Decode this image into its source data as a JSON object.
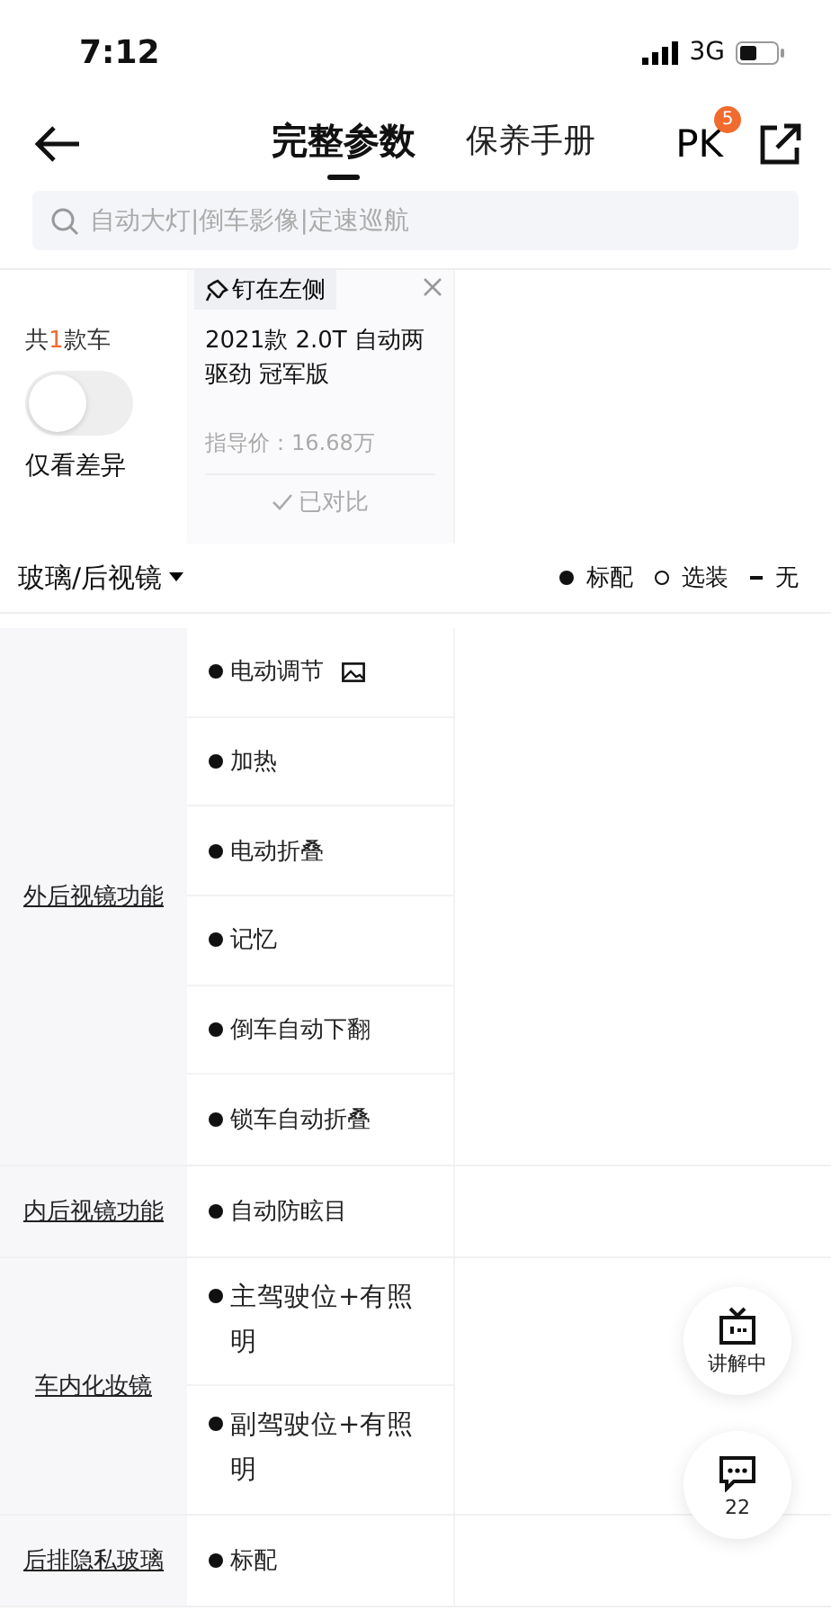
{
  "status_bar": {
    "time": "7:12",
    "network": "3G"
  },
  "nav": {
    "tabs": [
      {
        "label": "完整参数",
        "selected": true
      },
      {
        "label": "保养手册",
        "selected": false
      }
    ],
    "pk": {
      "label": "PK",
      "badge": "5"
    }
  },
  "search": {
    "placeholder": "自动大灯|倒车影像|定速巡航"
  },
  "header": {
    "count": {
      "before": "共",
      "number": "1",
      "after": "款车"
    },
    "diff_toggle": {
      "label": "仅看差异",
      "on": false
    },
    "car": {
      "pin": "钉在左侧",
      "name": "2021款 2.0T 自动两驱劲 冠军版",
      "price": "指导价：16.68万",
      "compared": "已对比"
    }
  },
  "section": {
    "title": "玻璃/后视镜",
    "legend": [
      {
        "kind": "standard",
        "label": "标配"
      },
      {
        "kind": "optional",
        "label": "选装"
      },
      {
        "kind": "none",
        "label": "无"
      }
    ]
  },
  "groups": [
    {
      "name": "外后视镜功能",
      "items": [
        {
          "kind": "standard",
          "text": "电动调节",
          "has_image": true
        },
        {
          "kind": "standard",
          "text": "加热",
          "has_image": false
        },
        {
          "kind": "standard",
          "text": "电动折叠",
          "has_image": false
        },
        {
          "kind": "standard",
          "text": "记忆",
          "has_image": false
        },
        {
          "kind": "standard",
          "text": "倒车自动下翻",
          "has_image": false
        },
        {
          "kind": "standard",
          "text": "锁车自动折叠",
          "has_image": false
        }
      ]
    },
    {
      "name": "内后视镜功能",
      "items": [
        {
          "kind": "standard",
          "text": "自动防眩目",
          "has_image": false
        }
      ]
    },
    {
      "name": "车内化妆镜",
      "items": [
        {
          "kind": "standard",
          "text": " 主驾驶位+有照明",
          "has_image": false
        },
        {
          "kind": "standard",
          "text": " 副驾驶位+有照明",
          "has_image": false
        }
      ]
    },
    {
      "name": "后排隐私玻璃",
      "items": [
        {
          "kind": "standard",
          "text": "标配",
          "has_image": false
        }
      ]
    }
  ],
  "floating": [
    {
      "kind": "live",
      "label": "讲解中"
    },
    {
      "kind": "comments",
      "label": "22"
    }
  ]
}
